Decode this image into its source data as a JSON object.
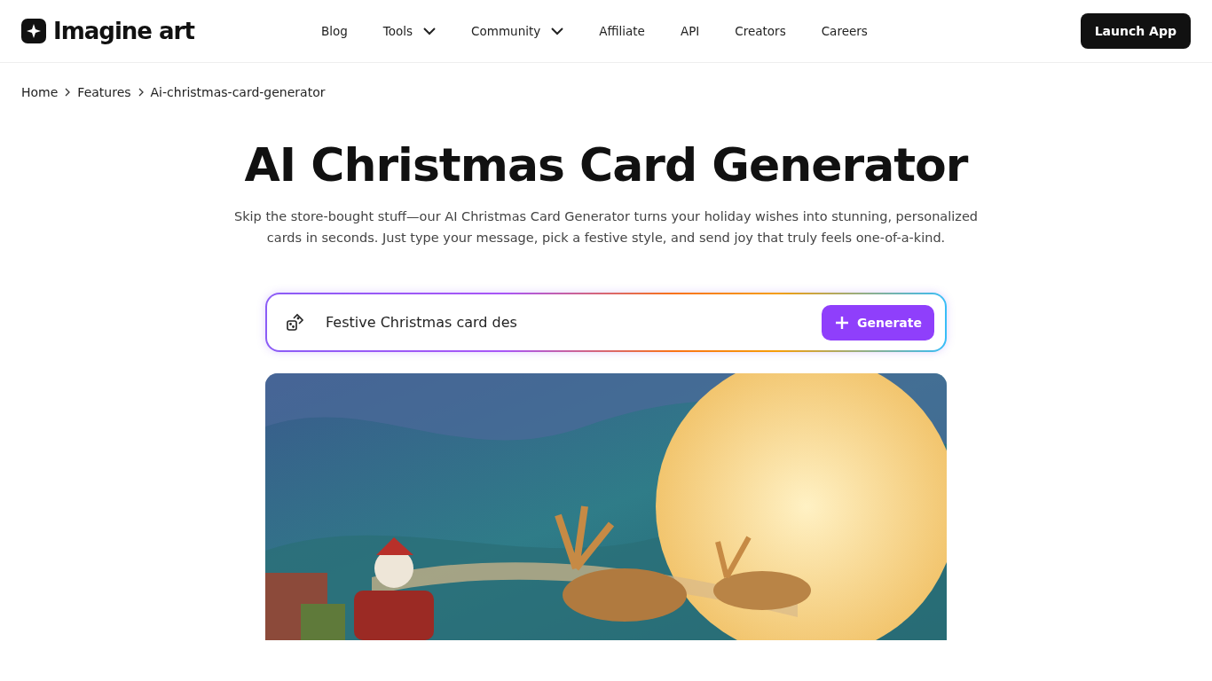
{
  "header": {
    "logo": "Imagine art",
    "nav": [
      {
        "label": "Blog",
        "dropdown": false
      },
      {
        "label": "Tools",
        "dropdown": true
      },
      {
        "label": "Community",
        "dropdown": true
      },
      {
        "label": "Affiliate",
        "dropdown": false
      },
      {
        "label": "API",
        "dropdown": false
      },
      {
        "label": "Creators",
        "dropdown": false
      },
      {
        "label": "Careers",
        "dropdown": false
      }
    ],
    "cta": "Launch App"
  },
  "breadcrumbs": [
    "Home",
    "Features",
    "Ai-christmas-card-generator"
  ],
  "hero": {
    "title": "AI Christmas Card Generator",
    "description": "Skip the store-bought stuff—our AI Christmas Card Generator turns your holiday wishes into stunning, personalized cards in seconds. Just type your message, pick a festive style, and send joy that truly feels one-of-a-kind."
  },
  "prompt": {
    "value": "Festive Christmas card des",
    "button": "Generate"
  }
}
